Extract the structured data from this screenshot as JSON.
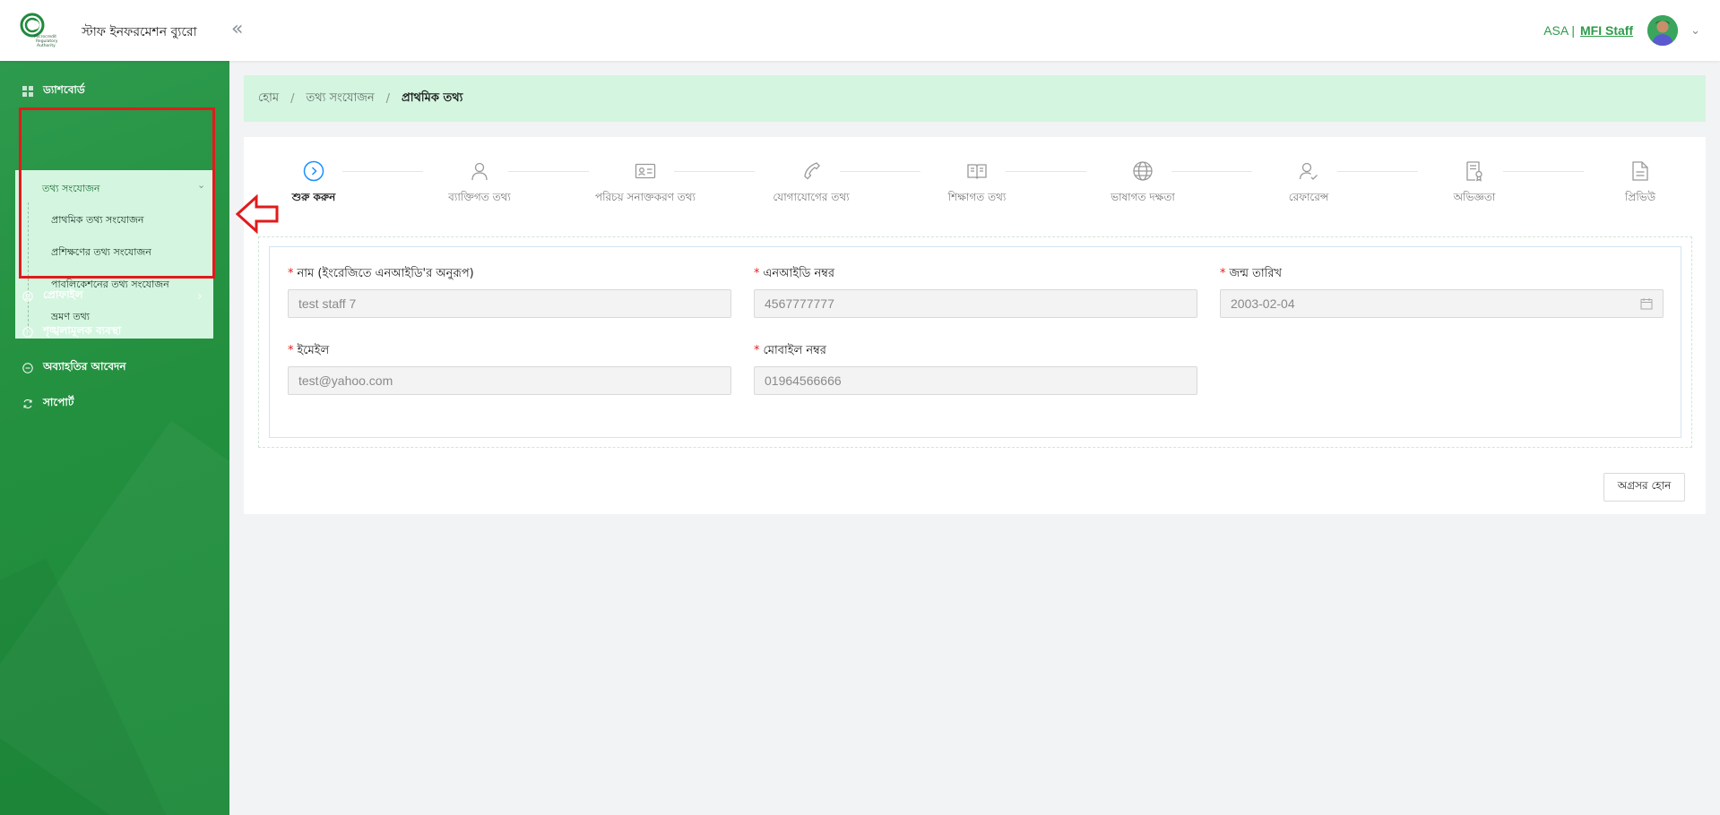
{
  "header": {
    "app_title": "স্টাফ ইনফরমেশন ব্যুরো",
    "logo_text": [
      "Microcredit",
      "Regulatory",
      "Authority"
    ],
    "collapse_icon": "double-chevron-left-icon",
    "org": "ASA |",
    "role": "MFI Staff"
  },
  "sidebar": {
    "items": [
      {
        "label": "ড্যাশবোর্ড",
        "icon": "dashboard-icon"
      },
      {
        "label": "প্রোফাইল",
        "icon": "user-circle-icon"
      },
      {
        "label": "শৃঙ্খলামূলক ব্যবস্থা",
        "icon": "info-circle-icon"
      },
      {
        "label": "অব্যাহতির আবেদন",
        "icon": "minus-circle-icon"
      },
      {
        "label": "সাপোর্ট",
        "icon": "sync-icon"
      }
    ],
    "submenu": {
      "parent": "তথ্য সংযোজন",
      "children": [
        "প্রাথমিক তথ্য সংযোজন",
        "প্রশিক্ষণের তথ্য সংযোজন",
        "পাবলিকেশনের তথ্য সংযোজন",
        "ভ্রমণ তথ্য"
      ]
    }
  },
  "breadcrumb": {
    "home": "হোম",
    "section": "তথ্য সংযোজন",
    "current": "প্রাথমিক তথ্য",
    "separator": "/"
  },
  "steps": [
    {
      "label": "শুরু করুন",
      "icon": "play-circle-icon",
      "active": true
    },
    {
      "label": "ব্যাক্তিগত তথ্য",
      "icon": "user-icon"
    },
    {
      "label": "পরিচয় সনাক্তকরণ তথ্য",
      "icon": "id-card-icon"
    },
    {
      "label": "যোগাযোগের তথ্য",
      "icon": "phone-icon"
    },
    {
      "label": "শিক্ষাগত তথ্য",
      "icon": "book-icon"
    },
    {
      "label": "ভাষাগত দক্ষতা",
      "icon": "globe-icon"
    },
    {
      "label": "রেফারেন্স",
      "icon": "user-check-icon"
    },
    {
      "label": "অভিজ্ঞতা",
      "icon": "certificate-icon"
    },
    {
      "label": "প্রিভিউ",
      "icon": "document-icon"
    }
  ],
  "form": {
    "required_mark": "*",
    "name": {
      "label": "নাম (ইংরেজিতে এনআইডি'র অনুরূপ)",
      "value": "test staff 7"
    },
    "nid": {
      "label": "এনআইডি নম্বর",
      "value": "4567777777"
    },
    "dob": {
      "label": "জন্ম তারিখ",
      "value": "2003-02-04"
    },
    "email": {
      "label": "ইমেইল",
      "value": "test@yahoo.com"
    },
    "mobile": {
      "label": "মোবাইল নম্বর",
      "value": "01964566666"
    }
  },
  "next_button": "অগ্রসর হোন",
  "colors": {
    "brand_green": "#2e9b4a",
    "highlight_red": "#e01b1b",
    "active_step_blue": "#1890ff"
  }
}
